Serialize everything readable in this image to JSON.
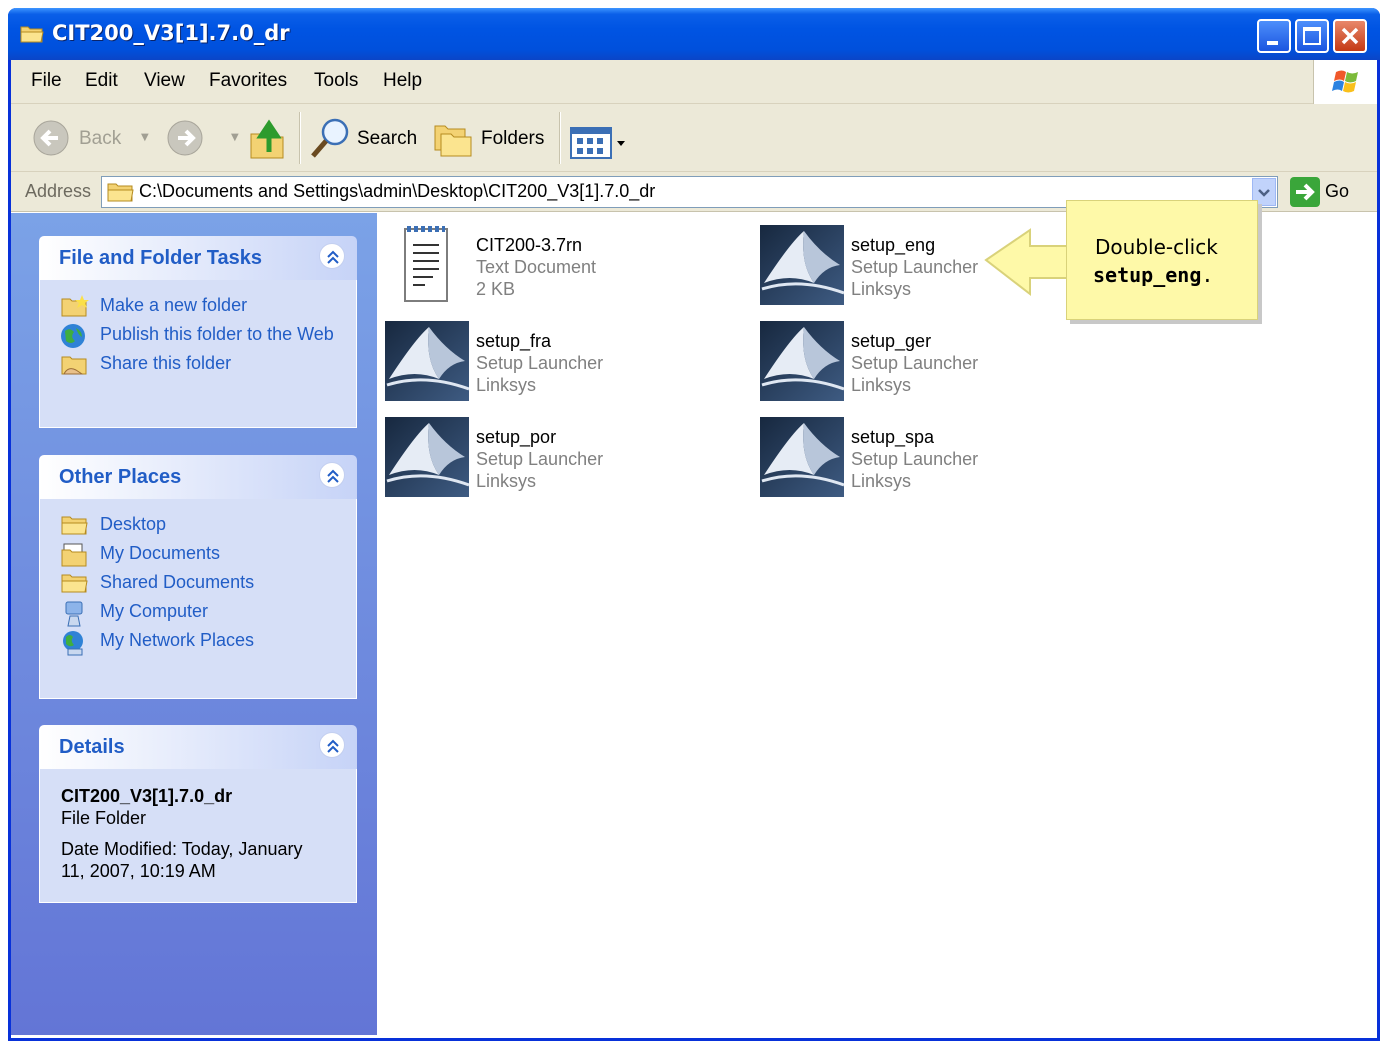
{
  "window": {
    "title": "CIT200_V3[1].7.0_dr"
  },
  "menu": {
    "items": [
      "File",
      "Edit",
      "View",
      "Favorites",
      "Tools",
      "Help"
    ]
  },
  "toolbar": {
    "back_label": "Back",
    "search_label": "Search",
    "folders_label": "Folders"
  },
  "address": {
    "label": "Address",
    "value": "C:\\Documents and Settings\\admin\\Desktop\\CIT200_V3[1].7.0_dr",
    "go_label": "Go"
  },
  "tasks_panel": {
    "title": "File and Folder Tasks",
    "items": [
      "Make a new folder",
      "Publish this folder to the Web",
      "Share this folder"
    ]
  },
  "places_panel": {
    "title": "Other Places",
    "items": [
      "Desktop",
      "My Documents",
      "Shared Documents",
      "My Computer",
      "My Network Places"
    ]
  },
  "details_panel": {
    "title": "Details",
    "name": "CIT200_V3[1].7.0_dr",
    "type": "File Folder",
    "modified": "Date Modified: Today, January 11, 2007, 10:19 AM"
  },
  "files": [
    {
      "name": "CIT200-3.7rn",
      "type": "Text Document",
      "extra": "2 KB",
      "icon": "text-document-icon"
    },
    {
      "name": "setup_eng",
      "type": "Setup Launcher",
      "extra": "Linksys",
      "icon": "setup-launcher-icon"
    },
    {
      "name": "setup_fra",
      "type": "Setup Launcher",
      "extra": "Linksys",
      "icon": "setup-launcher-icon"
    },
    {
      "name": "setup_ger",
      "type": "Setup Launcher",
      "extra": "Linksys",
      "icon": "setup-launcher-icon"
    },
    {
      "name": "setup_por",
      "type": "Setup Launcher",
      "extra": "Linksys",
      "icon": "setup-launcher-icon"
    },
    {
      "name": "setup_spa",
      "type": "Setup Launcher",
      "extra": "Linksys",
      "icon": "setup-launcher-icon"
    }
  ],
  "callout": {
    "line1": "Double-click",
    "line2": "setup_eng",
    "line2_suffix": "."
  }
}
